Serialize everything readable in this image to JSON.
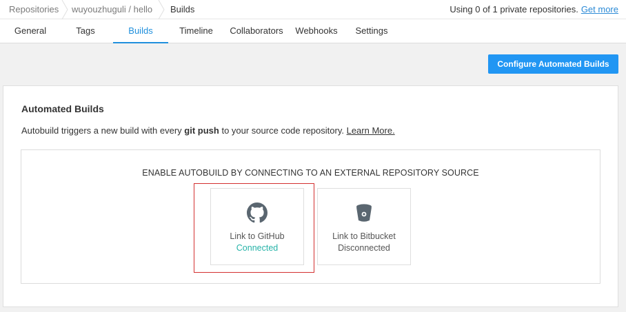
{
  "breadcrumb": {
    "items": [
      "Repositories",
      "wuyouzhuguli / hello",
      "Builds"
    ]
  },
  "usage": {
    "text": "Using 0 of 1 private repositories.",
    "link": "Get more"
  },
  "tabs": [
    {
      "label": "General",
      "active": false
    },
    {
      "label": "Tags",
      "active": false
    },
    {
      "label": "Builds",
      "active": true
    },
    {
      "label": "Timeline",
      "active": false
    },
    {
      "label": "Collaborators",
      "active": false
    },
    {
      "label": "Webhooks",
      "active": false
    },
    {
      "label": "Settings",
      "active": false
    }
  ],
  "configure_button": "Configure Automated Builds",
  "panel": {
    "title": "Automated Builds",
    "desc_pre": "Autobuild triggers a new build with every ",
    "desc_bold": "git push",
    "desc_post": " to your source code repository. ",
    "learn_more": "Learn More.",
    "enable_heading": "ENABLE AUTOBUILD BY CONNECTING TO AN EXTERNAL REPOSITORY SOURCE",
    "cards": [
      {
        "icon": "github-icon",
        "label": "Link to GitHub",
        "status": "Connected",
        "status_color": "#26b3a8"
      },
      {
        "icon": "bitbucket-icon",
        "label": "Link to Bitbucket",
        "status": "Disconnected",
        "status_color": "#555555"
      }
    ]
  },
  "colors": {
    "accent": "#2196f3",
    "active_tab": "#1f8fdc",
    "highlight_border": "#d32f2f",
    "connected": "#26b3a8"
  }
}
